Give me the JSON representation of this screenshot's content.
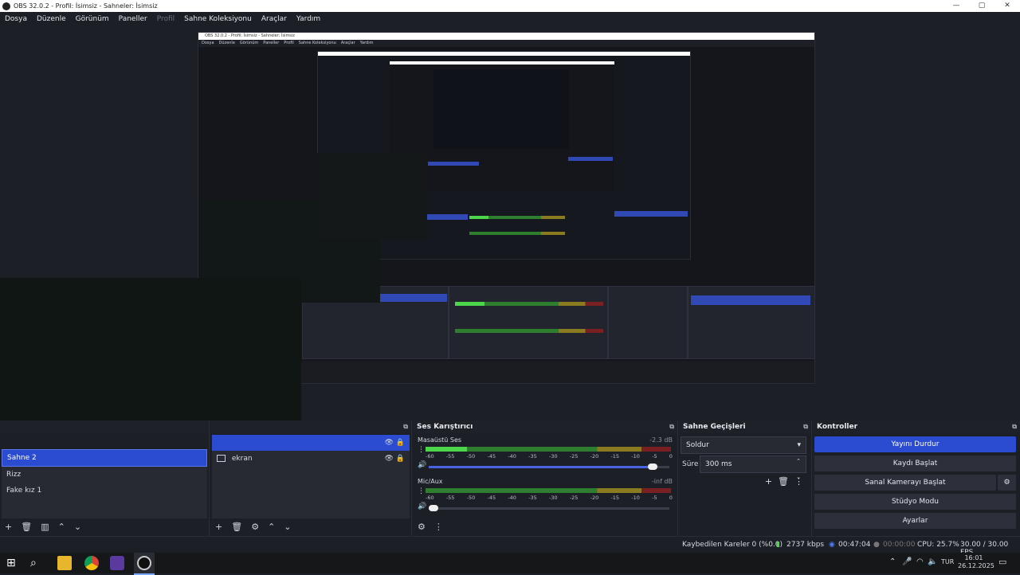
{
  "window": {
    "title": "OBS 32.0.2 - Profil: İsimsiz - Sahneler: İsimsiz",
    "controls": [
      "—",
      "▢",
      "✕"
    ]
  },
  "menu": [
    "Dosya",
    "Düzenle",
    "Görünüm",
    "Paneller",
    "Profil",
    "Sahne Koleksiyonu",
    "Araçlar",
    "Yardım"
  ],
  "recursive_menu": [
    "Dosya",
    "Düzenle",
    "Görünüm",
    "Paneller",
    "Profil",
    "Sahne Koleksiyonu",
    "Araçlar",
    "Yardım"
  ],
  "scenes": {
    "items": [
      "Sahne 2",
      "Rizz",
      "Fake kız 1"
    ],
    "selected": "Sahne 2"
  },
  "sources": {
    "items": [
      "ekran"
    ]
  },
  "mixer": {
    "title": "Ses Karıştırıcı",
    "channels": [
      {
        "name": "Masaüstü Ses",
        "db": "-2.3 dB",
        "level": 0.17,
        "volume": 0.93
      },
      {
        "name": "Mic/Aux",
        "db": "-inf dB",
        "level": 0.0,
        "volume": 0.02
      }
    ],
    "ticks": [
      "-60",
      "-55",
      "-50",
      "-45",
      "-40",
      "-35",
      "-30",
      "-25",
      "-20",
      "-15",
      "-10",
      "-5",
      "0"
    ]
  },
  "transitions": {
    "title": "Sahne Geçişleri",
    "transition": "Soldur",
    "duration_label": "Süre",
    "duration": "300 ms"
  },
  "controls": {
    "title": "Kontroller",
    "buttons": [
      "Yayını Durdur",
      "Kaydı Başlat",
      "Sanal Kamerayı Başlat",
      "Stüdyo Modu",
      "Ayarlar"
    ]
  },
  "status": {
    "dropped": "Kaybedilen Kareler 0 (%0.0)",
    "bitrate": "2737 kbps",
    "stream_time": "00:47:04",
    "rec_time": "00:00:00",
    "cpu": "CPU: 25.7%",
    "fps": "30.00 / 30.00 FPS"
  },
  "taskbar": {
    "lang": "TUR",
    "time": "16:01",
    "date": "26.12.2025"
  },
  "colors": {
    "accent": "#2b4cd0",
    "bg": "#1d1f26",
    "meter_green": "#4cd64c"
  }
}
